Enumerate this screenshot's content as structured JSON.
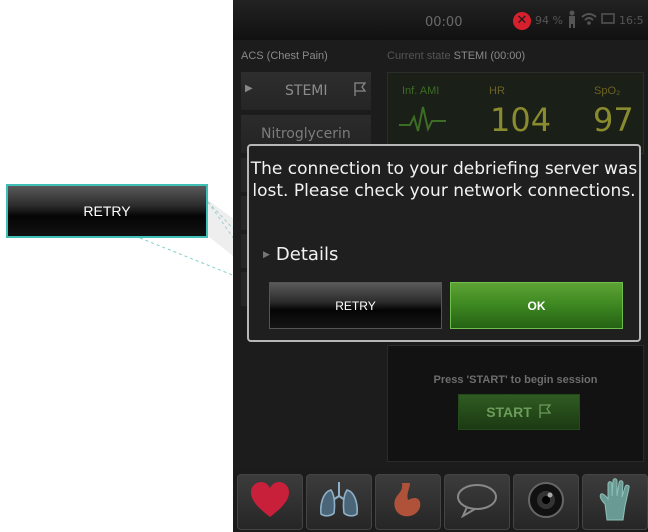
{
  "callout": {
    "label": "RETRY"
  },
  "status_bar": {
    "clock": "00:00",
    "battery_percent": "94 %",
    "time": "16:5"
  },
  "case": {
    "title": "ACS (Chest Pain)"
  },
  "current_state": {
    "label": "Current state",
    "value": "STEMI (00:00)"
  },
  "sidebar": {
    "items": [
      {
        "label": "STEMI",
        "icon": "flag-icon"
      },
      {
        "label": "Nitroglycerin"
      }
    ]
  },
  "monitor": {
    "rhythm_label": "Inf. AMI",
    "hr_label": "HR",
    "hr_value": "104",
    "spo2_label": "SpO₂",
    "spo2_value": "97"
  },
  "dialog": {
    "message": "The connection to your debriefing server was lost. Please check your network connections.",
    "details_label": "Details",
    "retry_label": "RETRY",
    "ok_label": "OK"
  },
  "session": {
    "hint": "Press 'START' to begin session",
    "start_label": "START"
  },
  "toolbar": {
    "buttons": [
      "heart-icon",
      "lungs-icon",
      "stomach-icon",
      "speech-bubble-icon",
      "eye-icon",
      "glove-icon"
    ]
  },
  "colors": {
    "callout_border": "#3fbfb6",
    "ok_green": "#3f8a22",
    "alert_red": "#d6202e",
    "vital_yellow": "#8a8b2e",
    "ecg_green": "#3c6d25"
  }
}
